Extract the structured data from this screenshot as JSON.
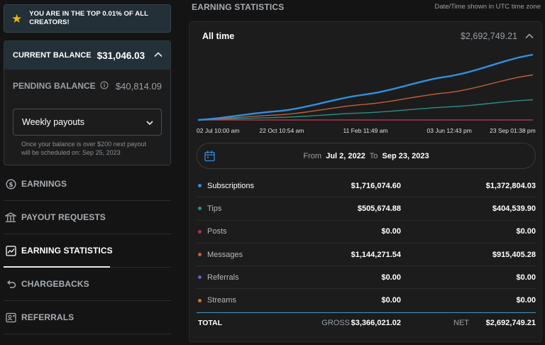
{
  "badge": {
    "text": "YOU ARE IN THE TOP 0.01% OF ALL CREATORS!",
    "icon": "star-icon"
  },
  "balance": {
    "current_label": "CURRENT BALANCE",
    "current_amount": "$31,046.03",
    "pending_label": "PENDING BALANCE",
    "pending_amount": "$40,814.09",
    "payout_select": "Weekly payouts",
    "note": "Once your balance is over $200 next payout will be scheduled on: Sep 25, 2023"
  },
  "nav": {
    "items": [
      {
        "label": "EARNINGS",
        "icon": "dollar-circle-icon",
        "active": false
      },
      {
        "label": "PAYOUT REQUESTS",
        "icon": "bank-icon",
        "active": false
      },
      {
        "label": "EARNING STATISTICS",
        "icon": "chart-icon",
        "active": true
      },
      {
        "label": "CHARGEBACKS",
        "icon": "undo-icon",
        "active": false
      },
      {
        "label": "REFERRALS",
        "icon": "referral-icon",
        "active": false
      }
    ]
  },
  "header": {
    "title": "EARNING STATISTICS",
    "timezone_note": "Date/Time shown in UTC time zone"
  },
  "stats": {
    "range_label": "All time",
    "total": "$2,692,749.21",
    "date_from_label": "From",
    "date_from": "Jul 2, 2022",
    "date_to_label": "To",
    "date_to": "Sep 23, 2023",
    "rows": [
      {
        "name": "Subscriptions",
        "gross": "$1,716,074.60",
        "net": "$1,372,804.03",
        "color": "#2f8fe0"
      },
      {
        "name": "Tips",
        "gross": "$505,674.88",
        "net": "$404,539.90",
        "color": "#2a8f86"
      },
      {
        "name": "Posts",
        "gross": "$0.00",
        "net": "$0.00",
        "color": "#b0324d"
      },
      {
        "name": "Messages",
        "gross": "$1,144,271.54",
        "net": "$915,405.28",
        "color": "#c0603a"
      },
      {
        "name": "Referrals",
        "gross": "$0.00",
        "net": "$0.00",
        "color": "#6b5bb0"
      },
      {
        "name": "Streams",
        "gross": "$0.00",
        "net": "$0.00",
        "color": "#c07a28"
      }
    ],
    "total_row": {
      "label": "TOTAL",
      "gross_label": "GROSS",
      "gross": "$3,366,021.02",
      "net_label": "NET",
      "net": "$2,692,749.21"
    }
  },
  "chart_data": {
    "type": "line",
    "x": [
      "02 Jul 10:00 am",
      "22 Oct 10:54 am",
      "11 Feb 11:49 am",
      "03 Jun 12:43 pm",
      "23 Sep 01:38 pm"
    ],
    "grid": false,
    "series": [
      {
        "name": "Subscriptions",
        "color": "#2f8fe0",
        "values": [
          0,
          0.14,
          0.39,
          0.67,
          1.0
        ]
      },
      {
        "name": "Messages",
        "color": "#c0603a",
        "values": [
          0,
          0.08,
          0.24,
          0.42,
          0.69
        ]
      },
      {
        "name": "Tips",
        "color": "#2a8f86",
        "values": [
          0,
          0.04,
          0.11,
          0.2,
          0.31
        ]
      },
      {
        "name": "Posts",
        "color": "#b0324d",
        "values": [
          0,
          0,
          0,
          0,
          0
        ]
      }
    ]
  }
}
